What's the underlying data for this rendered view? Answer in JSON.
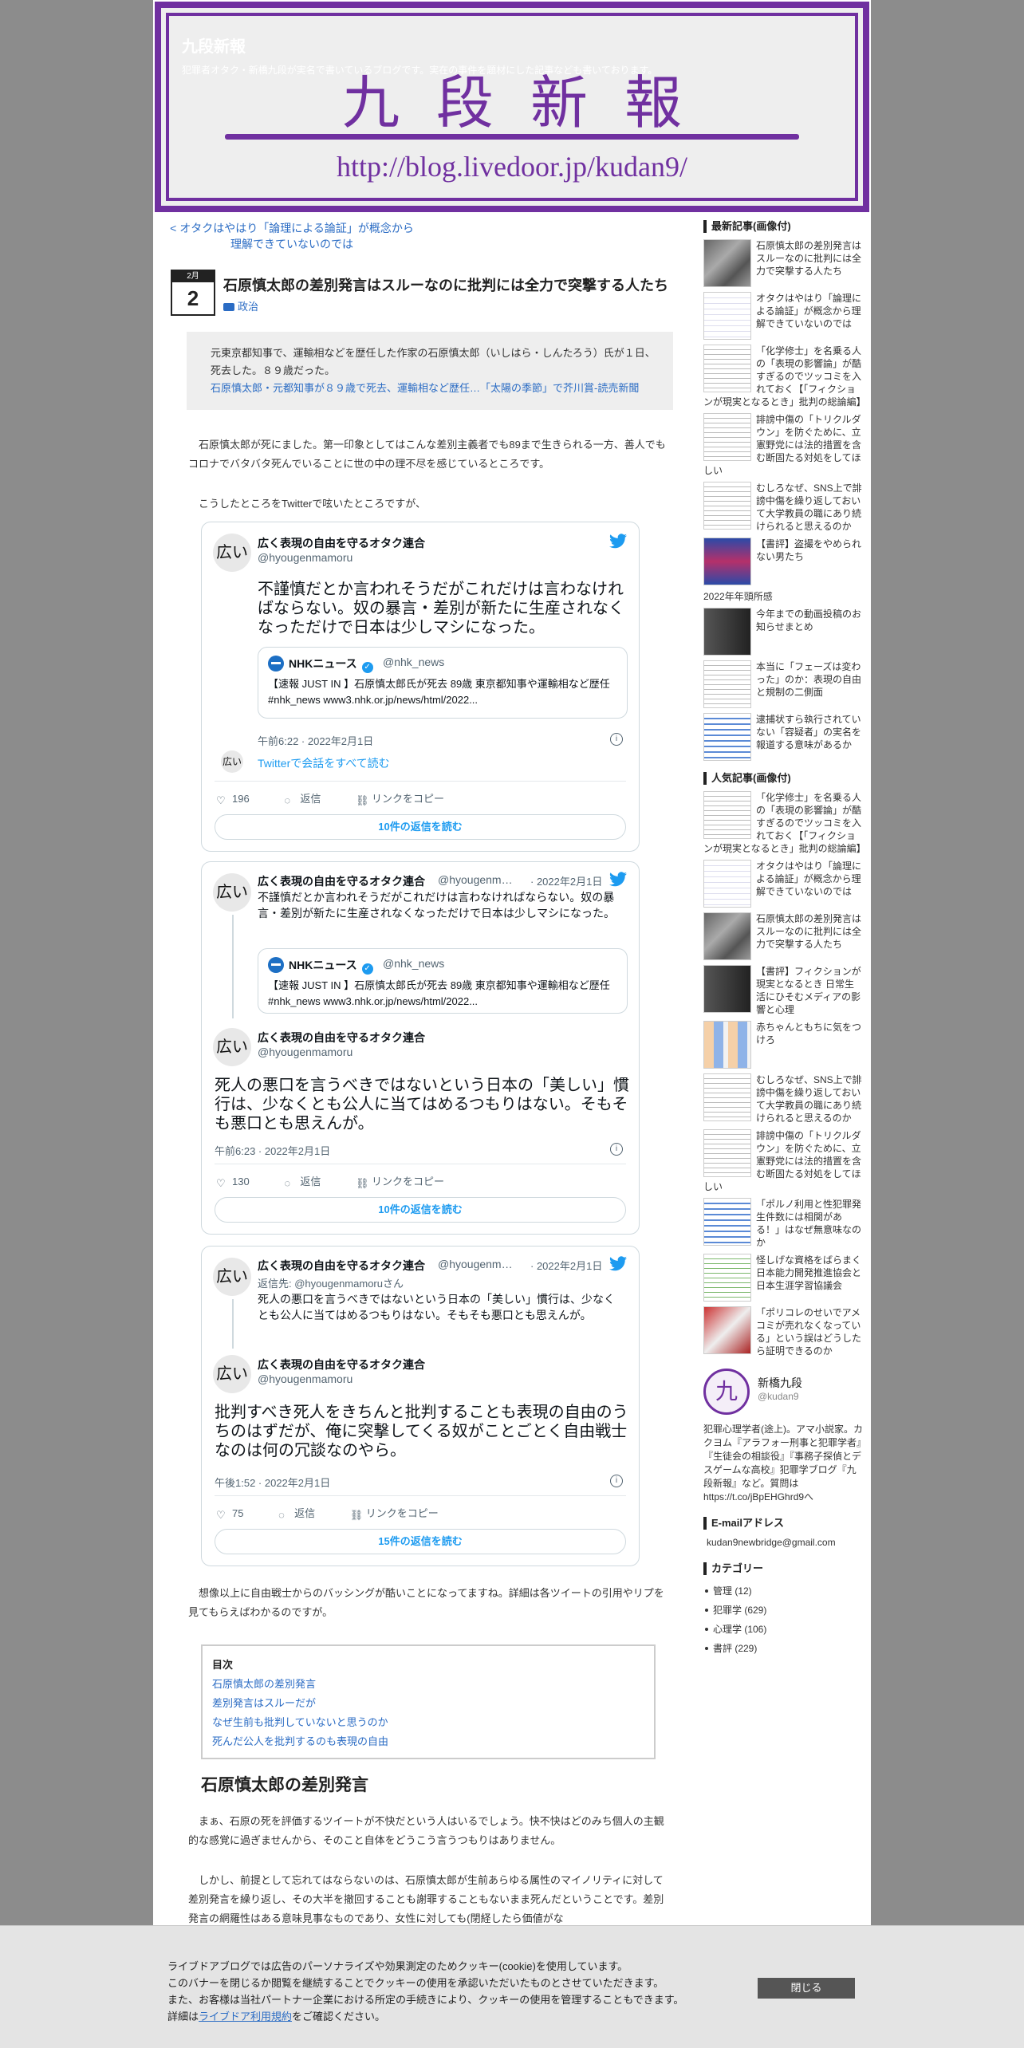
{
  "header": {
    "site_title": "九段新報",
    "site_desc": "犯罪者オタク・新橋九段が実名で書いているブログです。実在の事件を題材にした記事なども書いております。",
    "banner_title": "九段新報",
    "banner_url": "http://blog.livedoor.jp/kudan9/"
  },
  "article": {
    "prev_link_line1": "< オタクはやはり「論理による論証」が概念から",
    "prev_link_line2": "理解できていないのでは",
    "date_month": "2月",
    "date_day": "2",
    "title": "石原慎太郎の差別発言はスルーなのに批判には全力で突撃する人たち",
    "category": "政治",
    "quote_text": "元東京都知事で、運輸相などを歴任した作家の石原慎太郎（いしはら・しんたろう）氏が１日、死去した。８９歳だった。",
    "quote_link": "石原慎太郎・元都知事が８９歳で死去、運輸相など歴任…「太陽の季節」で芥川賞-読売新聞",
    "para1": "石原慎太郎が死にました。第一印象としてはこんな差別主義者でも89まで生きられる一方、善人でもコロナでバタバタ死んでいることに世の中の理不尽を感じているところです。",
    "para2": "こうしたところをTwitterで呟いたところですが、",
    "para3": "想像以上に自由戦士からのバッシングが酷いことになってますね。詳細は各ツイートの引用やリプを見てもらえばわかるのですが。",
    "toc_title": "目次",
    "toc": [
      "石原慎太郎の差別発言",
      "差別発言はスルーだが",
      "なぜ生前も批判していないと思うのか",
      "死んだ公人を批判するのも表現の自由"
    ],
    "h2": "石原慎太郎の差別発言",
    "para4": "まぁ、石原の死を評価するツイートが不快だという人はいるでしょう。快不快はどのみち個人の主観的な感覚に過ぎませんから、そのこと自体をどうこう言うつもりはありません。",
    "para5": "しかし、前提として忘れてはならないのは、石原慎太郎が生前あらゆる属性のマイノリティに対して差別発言を繰り返し、その大半を撤回することも謝罪することもないまま死んだということです。差別発言の網羅性はある意味見事なものであり、女性に対しても(閉経したら価値がな"
  },
  "tweets": [
    {
      "avatar": "広い",
      "name": "広く表現の自由を守るオタク連合",
      "handle": "@hyougenmamoru",
      "text": "不謹慎だとか言われそうだがこれだけは言わなければならない。奴の暴言・差別が新たに生産されなくなっただけで日本は少しマシになった。",
      "quoted_name": "NHKニュース",
      "quoted_handle": "@nhk_news",
      "quoted_text": "【速報 JUST IN 】石原慎太郎氏が死去 89歳 東京都知事や運輸相など歴任 #nhk_news www3.nhk.or.jp/news/html/2022...",
      "time": "午前6:22 · 2022年2月1日",
      "conv_avatar": "広い",
      "conv": "Twitterで会話をすべて読む",
      "likes": "196",
      "reply": "返信",
      "copy": "リンクをコピー",
      "button": "10件の返信を読む"
    },
    {
      "avatar": "広い",
      "name": "広く表現の自由を守るオタク連合",
      "handle": "@hyougenm…",
      "date": "· 2022年2月1日",
      "text": "不謹慎だとか言われそうだがこれだけは言わなければならない。奴の暴言・差別が新たに生産されなくなっただけで日本は少しマシになった。",
      "quoted_name": "NHKニュース",
      "quoted_handle": "@nhk_news",
      "quoted_text": "【速報 JUST IN 】石原慎太郎氏が死去 89歳 東京都知事や運輸相など歴任 #nhk_news www3.nhk.or.jp/news/html/2022...",
      "avatar2": "広い",
      "name2": "広く表現の自由を守るオタク連合",
      "handle2": "@hyougenmamoru",
      "text2": "死人の悪口を言うべきではないという日本の「美しい」慣行は、少なくとも公人に当てはめるつもりはない。そもそも悪口とも思えんが。",
      "time": "午前6:23 · 2022年2月1日",
      "likes": "130",
      "reply": "返信",
      "copy": "リンクをコピー",
      "button": "10件の返信を読む"
    },
    {
      "avatar": "広い",
      "name": "広く表現の自由を守るオタク連合",
      "handle": "@hyougenm…",
      "date": "· 2022年2月1日",
      "reply_to": "返信先: @hyougenmamoruさん",
      "text": "死人の悪口を言うべきではないという日本の「美しい」慣行は、少なくとも公人に当てはめるつもりはない。そもそも悪口とも思えんが。",
      "avatar2": "広い",
      "name2": "広く表現の自由を守るオタク連合",
      "handle2": "@hyougenmamoru",
      "text2": "批判すべき死人をきちんと批判することも表現の自由のうちのはずだが、俺に突撃してくる奴がことごとく自由戦士なのは何の冗談なのやら。",
      "time": "午後1:52 · 2022年2月1日",
      "likes": "75",
      "reply": "返信",
      "copy": "リンクをコピー",
      "button": "15件の返信を読む"
    }
  ],
  "sidebar": {
    "recent_title": "最新記事(画像付)",
    "recent": [
      "石原慎太郎の差別発言はスルーなのに批判には全力で突撃する人たち",
      "オタクはやはり「論理による論証」が概念から理解できていないのでは",
      "「化学修士」を名乗る人の「表現の影響論」が酷すぎるのでツッコミを入れておく【「フィクションが現実となるとき」批判の総論編】",
      "誹謗中傷の「トリクルダウン」を防ぐために、立憲野党には法的措置を含む断固たる対処をしてほしい",
      "むしろなぜ、SNS上で誹謗中傷を繰り返しておいて大学教員の職にあり続けられると思えるのか",
      "【書評】盗撮をやめられない男たち",
      "2022年年頭所感",
      "今年までの動画投稿のお知らせまとめ",
      "本当に「フェーズは変わった」のか：表現の自由と規制の二側面",
      "逮捕状すら執行されていない「容疑者」の実名を報道する意味があるか"
    ],
    "popular_title": "人気記事(画像付)",
    "popular": [
      "「化学修士」を名乗る人の「表現の影響論」が酷すぎるのでツッコミを入れておく【「フィクションが現実となるとき」批判の総論編】",
      "オタクはやはり「論理による論証」が概念から理解できていないのでは",
      "石原慎太郎の差別発言はスルーなのに批判には全力で突撃する人たち",
      "【書評】フィクションが現実となるとき 日常生活にひそむメディアの影響と心理",
      "赤ちゃんともちに気をつけろ",
      "むしろなぜ、SNS上で誹謗中傷を繰り返しておいて大学教員の職にあり続けられると思えるのか",
      "誹謗中傷の「トリクルダウン」を防ぐために、立憲野党には法的措置を含む断固たる対処をしてほしい",
      "「ポルノ利用と性犯罪発生件数には相関がある！」はなぜ無意味なのか",
      "怪しげな資格をばらまく日本能力開発推進協会と日本生涯学習協議会",
      "「ポリコレのせいでアメコミが売れなくなっている」という誤はどうしたら証明できるのか"
    ],
    "profile_avatar": "九",
    "profile_name": "新橋九段",
    "profile_id": "@kudan9",
    "profile_desc": "犯罪心理学者(途上)。アマ小説家。カクヨム『アラフォー刑事と犯罪学者』『生徒会の相談役』『事務子探偵とデスゲームな高校』犯罪学ブログ『九段新報』など。質問は https://t.co/jBpEHGhrd9へ",
    "email_title": "E-mailアドレス",
    "email": "kudan9newbridge@gmail.com",
    "category_title": "カテゴリー",
    "categories": [
      "管理 (12)",
      "犯罪学 (629)",
      "心理学 (106)",
      "書評 (229)"
    ]
  },
  "cookie": {
    "line1": "ライブドアブログでは広告のパーソナライズや効果測定のためクッキー(cookie)を使用しています。",
    "line2": "このバナーを閉じるか閲覧を継続することでクッキーの使用を承認いただいたものとさせていただきます。",
    "line3": "また、お客様は当社パートナー企業における所定の手続きにより、クッキーの使用を管理することもできます。",
    "line4_pre": "詳細は",
    "line4_link": "ライブドア利用規約",
    "line4_post": "をご確認ください。",
    "close": "閉じる"
  }
}
